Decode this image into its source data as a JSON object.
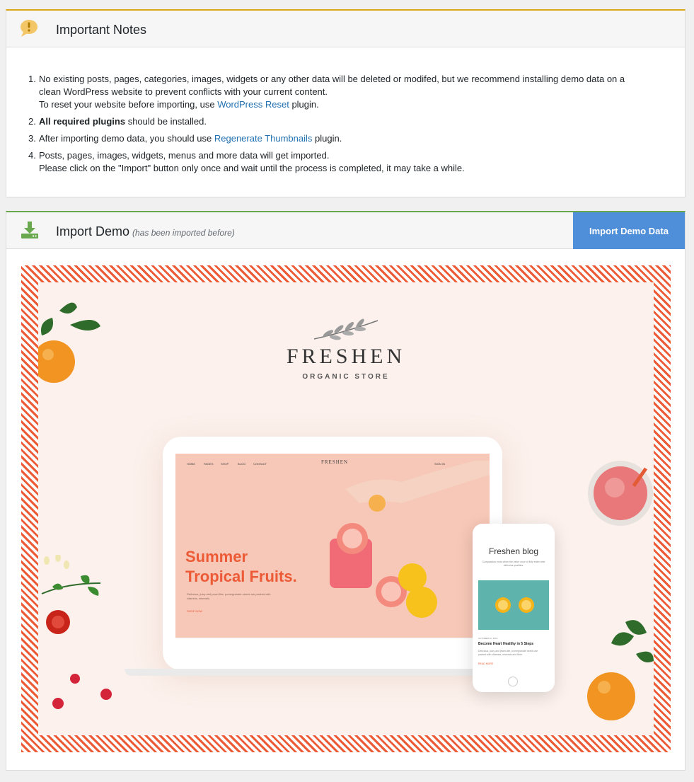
{
  "notes": {
    "title": "Important Notes",
    "items": [
      {
        "number": "1.",
        "line1": "No existing posts, pages, categories, images, widgets or any other data will be deleted or modifed, but we recommend installing demo data on a",
        "line2": "clean WordPress website to prevent conflicts with your current content.",
        "line3_pre": "To reset your website before importing, use ",
        "line3_link": "WordPress Reset",
        "line3_post": " plugin."
      },
      {
        "number": "2.",
        "bold": "All required plugins",
        "rest": " should be installed."
      },
      {
        "number": "3.",
        "pre": "After importing demo data, you should use ",
        "link": "Regenerate Thumbnails",
        "post": " plugin."
      },
      {
        "number": "4.",
        "line1": "Posts, pages, images, widgets, menus and more data will get imported.",
        "line2": "Please click on the \"Import\" button only once and wait until the process is completed, it may take a while."
      }
    ]
  },
  "import": {
    "title": "Import Demo",
    "subnote": "(has been imported before)",
    "button_label": "Import Demo Data"
  },
  "preview": {
    "logo": "FRESHEN",
    "logo_sub": "ORGANIC STORE",
    "laptop": {
      "nav": [
        "HOME",
        "PAGES",
        "SHOP",
        "BLOG",
        "CONTACT"
      ],
      "nav_logo": "FRESHEN",
      "sign_in": "SIGN IN",
      "hero_line1": "Summer",
      "hero_line2": "Tropical Fruits.",
      "hero_body": "Delicious, juicy and jewel-like, pomegranate seeds are packed with vitamins, minerals.",
      "hero_link": "SHOP NOW"
    },
    "phone": {
      "title": "Freshen blog",
      "desc": "Compassion ends when the value once of fully eaten and delicious qualities.",
      "date": "OCTOBER 22, 2019",
      "post_title": "Become Heart Healthy in 5 Steps",
      "excerpt": "Delicious, juicy and jewel-like, pomegranate seeds are packed with vitamins, minerals and fibre.",
      "more": "READ MORE"
    }
  },
  "colors": {
    "notes_border": "#dba617",
    "import_border": "#6aa84f",
    "button": "#4f8ed8",
    "link": "#2271b1",
    "accent": "#ec5a36"
  }
}
